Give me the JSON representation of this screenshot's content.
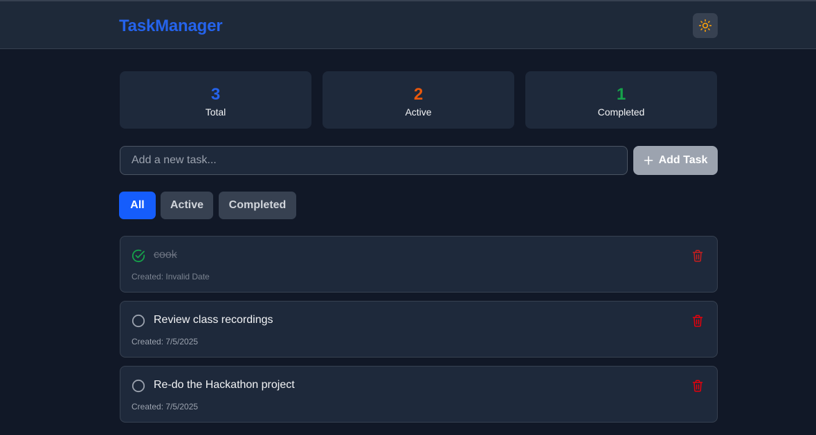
{
  "header": {
    "brand": "TaskManager",
    "theme_icon": "sun-icon"
  },
  "stats": [
    {
      "value": "3",
      "label": "Total",
      "color": "#2563eb"
    },
    {
      "value": "2",
      "label": "Active",
      "color": "#ea580c"
    },
    {
      "value": "1",
      "label": "Completed",
      "color": "#16a34a"
    }
  ],
  "new_task": {
    "placeholder": "Add a new task...",
    "value": "",
    "add_label": "Add Task",
    "add_icon": "plus-icon"
  },
  "filters": [
    {
      "label": "All",
      "selected": true
    },
    {
      "label": "Active",
      "selected": false
    },
    {
      "label": "Completed",
      "selected": false
    }
  ],
  "tasks": [
    {
      "title": "cook",
      "created": "Created: Invalid Date",
      "completed": true
    },
    {
      "title": "Review class recordings",
      "created": "Created: 7/5/2025",
      "completed": false
    },
    {
      "title": "Re-do the Hackathon project",
      "created": "Created: 7/5/2025",
      "completed": false
    }
  ],
  "colors": {
    "accent": "#155dfc",
    "delete": "#e7000b",
    "check_done": "#16a34a"
  }
}
